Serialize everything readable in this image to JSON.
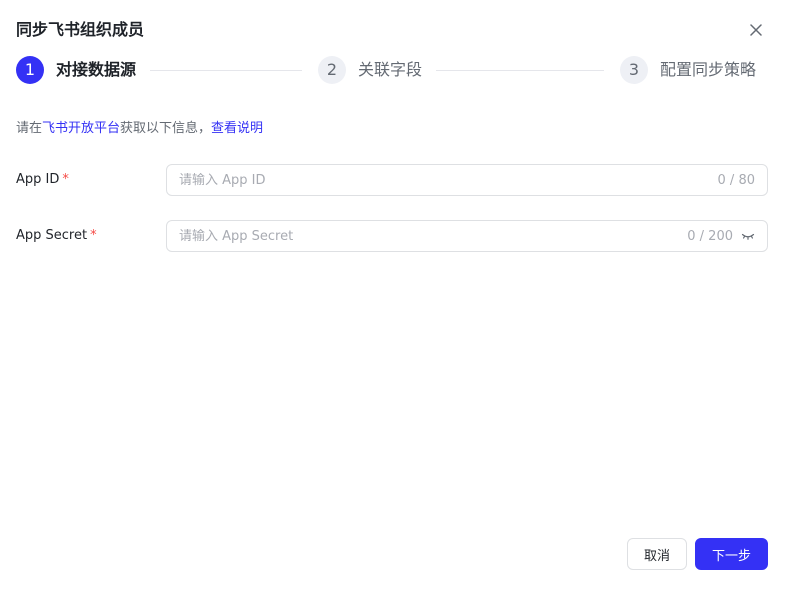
{
  "dialog": {
    "title": "同步飞书组织成员",
    "close_icon": "close-icon"
  },
  "steps": [
    {
      "number": "1",
      "label": "对接数据源",
      "state": "active"
    },
    {
      "number": "2",
      "label": "关联字段",
      "state": "inactive"
    },
    {
      "number": "3",
      "label": "配置同步策略",
      "state": "inactive"
    }
  ],
  "hint": {
    "prefix": "请在",
    "platform_link": "飞书开放平台",
    "middle": "获取以下信息，",
    "help_link": "查看说明"
  },
  "form": {
    "app_id": {
      "label": "App ID",
      "required_mark": "*",
      "value": "",
      "placeholder": "请输入 App ID",
      "counter": "0 / 80"
    },
    "app_secret": {
      "label": "App Secret",
      "required_mark": "*",
      "value": "",
      "placeholder": "请输入 App Secret",
      "counter": "0 / 200",
      "toggle_icon": "eye-closed-icon"
    }
  },
  "footer": {
    "cancel_label": "取消",
    "next_label": "下一步"
  },
  "colors": {
    "accent": "#3431f5",
    "required": "#f54a45",
    "border": "#dee0e3"
  }
}
